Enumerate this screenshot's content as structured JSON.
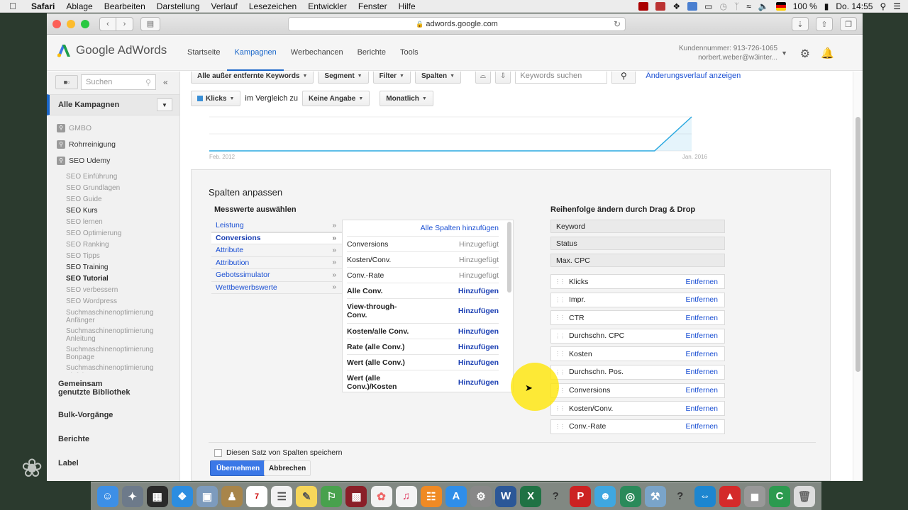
{
  "menubar": {
    "app": "Safari",
    "items": [
      "Ablage",
      "Bearbeiten",
      "Darstellung",
      "Verlauf",
      "Lesezeichen",
      "Entwickler",
      "Fenster",
      "Hilfe"
    ],
    "battery": "100 %",
    "clock": "Do. 14:55"
  },
  "browser": {
    "url": "adwords.google.com"
  },
  "header": {
    "logo_text": "Google AdWords",
    "nav": [
      "Startseite",
      "Kampagnen",
      "Werbechancen",
      "Berichte",
      "Tools"
    ],
    "customer_number": "Kundennummer: 913-726-1065",
    "account_email": "norbert.weber@w3inter..."
  },
  "sidebar": {
    "search_placeholder": "Suchen",
    "all_campaigns": "Alle Kampagnen",
    "campaigns": [
      "GMBO",
      "Rohrreinigung",
      "SEO Udemy"
    ],
    "adgroups": [
      "SEO Einführung",
      "SEO Grundlagen",
      "SEO Guide",
      "SEO Kurs",
      "SEO lernen",
      "SEO Optimierung",
      "SEO Ranking",
      "SEO Tipps",
      "SEO Training",
      "SEO Tutorial",
      "SEO verbessern",
      "SEO Wordpress",
      "Suchmaschinenoptimierung Anfänger",
      "Suchmaschinenoptimierung Anleitung",
      "Suchmaschinenoptimierung Bonpage",
      "Suchmaschinenoptimierung Einführung"
    ],
    "sections": [
      "Gemeinsam genutzte Bibliothek",
      "Bulk-Vorgänge",
      "Berichte",
      "Label"
    ]
  },
  "filters": {
    "keywords_filter": "Alle außer entfernte Keywords",
    "segment": "Segment",
    "filter": "Filter",
    "columns": "Spalten",
    "search_placeholder": "Keywords suchen",
    "history_link": "Änderungsverlauf anzeigen",
    "metric": "Klicks",
    "compare_label": "im Vergleich zu",
    "compare_value": "Keine Angabe",
    "period": "Monatlich"
  },
  "chart_data": {
    "type": "line",
    "x_labels": [
      "Feb. 2012",
      "Jan. 2016"
    ],
    "y_ticks": [
      0,
      1,
      2
    ],
    "series": [
      {
        "values": [
          0,
          0,
          0,
          0,
          0,
          0,
          0,
          0,
          0,
          0,
          0,
          0,
          0,
          2
        ]
      }
    ],
    "ylim": [
      0,
      2
    ]
  },
  "panel": {
    "title": "Spalten anpassen",
    "metrics_heading": "Messwerte auswählen",
    "order_heading": "Reihenfolge ändern durch Drag & Drop",
    "categories": [
      "Leistung",
      "Conversions",
      "Attribute",
      "Attribution",
      "Gebotssimulator",
      "Wettbewerbswerte"
    ],
    "add_all": "Alle Spalten hinzufügen",
    "metrics": [
      {
        "name": "Conversions",
        "status": "Hinzugefügt"
      },
      {
        "name": "Kosten/Conv.",
        "status": "Hinzugefügt"
      },
      {
        "name": "Conv.-Rate",
        "status": "Hinzugefügt"
      },
      {
        "name": "Alle Conv.",
        "status": "Hinzufügen"
      },
      {
        "name": "View-through-Conv.",
        "status": "Hinzufügen"
      },
      {
        "name": "Kosten/alle Conv.",
        "status": "Hinzufügen"
      },
      {
        "name": "Rate (alle Conv.)",
        "status": "Hinzufügen"
      },
      {
        "name": "Wert (alle Conv.)",
        "status": "Hinzufügen"
      },
      {
        "name": "Wert (alle Conv.)/Kosten",
        "status": "Hinzufügen"
      }
    ],
    "fixed_columns": [
      "Keyword",
      "Status",
      "Max. CPC"
    ],
    "order_columns": [
      "Klicks",
      "Impr.",
      "CTR",
      "Durchschn. CPC",
      "Kosten",
      "Durchschn. Pos.",
      "Conversions",
      "Kosten/Conv.",
      "Conv.-Rate"
    ],
    "remove_label": "Entfernen",
    "save_set": "Diesen Satz von Spalten speichern",
    "apply": "Übernehmen",
    "cancel": "Abbrechen"
  },
  "colors": {
    "accent": "#1a66c9",
    "link": "#1a4fd3",
    "chart_line": "#29a8e0",
    "highlight": "#ffe600"
  }
}
